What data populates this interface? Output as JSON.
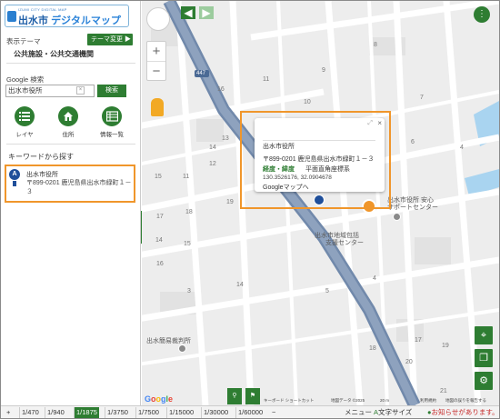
{
  "app": {
    "logo_small": "IZUMI CITY DIGITAL MAP",
    "logo_city": "出水市",
    "logo_main": "デジタルマップ"
  },
  "sidebar": {
    "theme_label": "表示テーマ",
    "theme_button": "テーマ変更",
    "theme_value": "公共施設・公共交通機関",
    "google_search_label": "Google 検索",
    "search_value": "出水市役所",
    "search_button": "検索",
    "quick_buttons": [
      {
        "label": "レイヤ",
        "icon": "layer-list-icon"
      },
      {
        "label": "住所",
        "icon": "home-icon"
      },
      {
        "label": "情報一覧",
        "icon": "info-list-icon"
      }
    ],
    "keyword_title": "キーワードから探す",
    "result": {
      "marker": "A",
      "name": "出水市役所",
      "address": "〒899-0201 鹿児島県出水市緑町１－３"
    }
  },
  "popup": {
    "title": "出水市役所",
    "address": "〒899-0201 鹿児島県出水市緑町１－３",
    "coord_label": "経度・緯度",
    "coord_system": "平面直角座標系",
    "coords": "130.3526176, 32.0904678",
    "google_link": "Googleマップへ"
  },
  "map": {
    "route_label": "447",
    "labels": {
      "city_hall": "出水市役所 安心",
      "support_center": "サポートセンター",
      "chiiki_1": "出水市地域包括",
      "chiiki_2": "支援センター",
      "court": "出水簡易裁判所"
    },
    "block_numbers": [
      "16",
      "11",
      "10",
      "9",
      "8",
      "7",
      "6",
      "4",
      "14",
      "13",
      "12",
      "11",
      "15",
      "19",
      "18",
      "17",
      "14",
      "15",
      "16",
      "14",
      "3",
      "5",
      "4",
      "18",
      "17",
      "19",
      "20",
      "21"
    ],
    "attribution": {
      "shortcuts": "キーボード ショートカット",
      "data": "地図データ ©2025",
      "scale": "20 m",
      "terms": "利用規約",
      "report": "地図の誤りを報告する"
    }
  },
  "bottom_bar": {
    "scales": [
      "1/470",
      "1/940",
      "1/1875",
      "1/3750",
      "1/7500",
      "1/15000",
      "1/30000",
      "1/60000"
    ],
    "active_scale": "1/1875",
    "minus": "−",
    "menu": "メニュー",
    "font_size": "文字サイズ",
    "notice": "お知らせがあります。"
  },
  "colors": {
    "brand_green": "#2e7d32",
    "highlight_orange": "#f0962b",
    "road_blue": "#6f87a8",
    "notice_red": "#c62828"
  }
}
